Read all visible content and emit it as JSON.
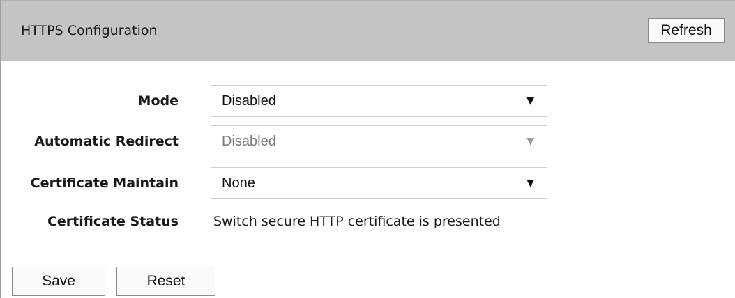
{
  "header": {
    "title": "HTTPS Configuration",
    "refresh_label": "Refresh"
  },
  "form": {
    "mode": {
      "label": "Mode",
      "value": "Disabled",
      "enabled": true
    },
    "automatic_redirect": {
      "label": "Automatic Redirect",
      "value": "Disabled",
      "enabled": false
    },
    "certificate_maintain": {
      "label": "Certificate Maintain",
      "value": "None",
      "enabled": true
    },
    "certificate_status": {
      "label": "Certificate Status",
      "value": "Switch secure HTTP certificate is presented"
    }
  },
  "footer": {
    "save_label": "Save",
    "reset_label": "Reset"
  },
  "icons": {
    "dropdown_arrow": "▼"
  },
  "colors": {
    "header_bg": "#c4c4c4",
    "disabled_text": "#7a7a7a"
  }
}
